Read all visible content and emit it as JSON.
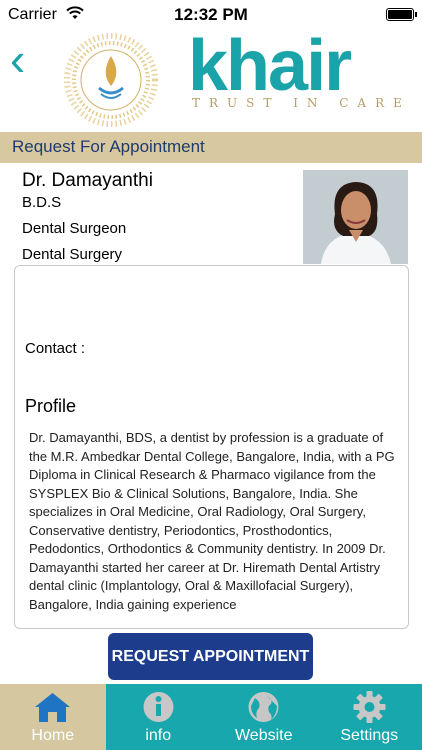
{
  "status_bar": {
    "carrier": "Carrier",
    "time": "12:32 PM"
  },
  "brand": {
    "name": "khair",
    "tagline": "TRUST IN CARE",
    "emblem_text": "SHIFA AL JAZEERA MEDICAL GROUP"
  },
  "page": {
    "title": "Request For Appointment"
  },
  "doctor": {
    "name": "Dr. Damayanthi",
    "degree": "B.D.S",
    "role": "Dental Surgeon",
    "department": "Dental Surgery",
    "contact_label": "Contact :",
    "profile_heading": "Profile",
    "profile_text": "Dr. Damayanthi, BDS, a dentist by profession is a graduate of the M.R. Ambedkar Dental College, Bangalore, India, with a PG Diploma in Clinical Research & Pharmaco vigilance from the SYSPLEX Bio & Clinical Solutions, Bangalore, India. She specializes in Oral Medicine, Oral Radiology, Oral Surgery, Conservative dentistry, Periodontics, Prosthodontics, Pedodontics, Orthodontics & Community dentistry. In 2009 Dr. Damayanthi started her career at Dr. Hiremath Dental Artistry dental clinic (Implantology, Oral & Maxillofacial Surgery), Bangalore, India gaining experience"
  },
  "actions": {
    "request_appointment": "REQUEST APPOINTMENT"
  },
  "tabs": [
    {
      "label": "Home",
      "icon": "home-icon"
    },
    {
      "label": "info",
      "icon": "info-icon"
    },
    {
      "label": "Website",
      "icon": "globe-icon"
    },
    {
      "label": "Settings",
      "icon": "gear-icon"
    }
  ],
  "colors": {
    "accent": "#17a7ac",
    "tan": "#d8c8a0",
    "button": "#1d3d8c",
    "title_text": "#1e3a70"
  }
}
